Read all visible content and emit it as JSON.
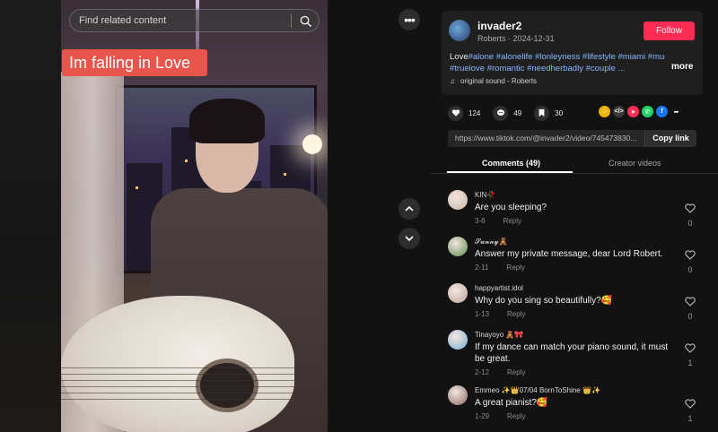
{
  "search": {
    "placeholder": "Find related content"
  },
  "video": {
    "caption_sticker": "Im falling in Love"
  },
  "author": {
    "username": "invader2",
    "nickname": "Roberts",
    "date": "2024-12-31",
    "follow_label": "Follow"
  },
  "description": {
    "line1_prefix": "Love",
    "line1_tags": [
      "#alone",
      "#alonelife",
      "#lonleyness",
      "#lifestyle",
      "#miami",
      "#music"
    ],
    "line2_tags": [
      "#truelove",
      "#romantic",
      "#needherbadly",
      "#couple ..."
    ],
    "more_label": "more"
  },
  "sound": {
    "label": "original sound - Roberts"
  },
  "actions": {
    "likes": "124",
    "comments": "49",
    "saves": "30"
  },
  "share_icons": [
    {
      "name": "embed-share-icon",
      "glyph": "</>",
      "color": "#3a3a3a"
    },
    {
      "name": "friends-share-icon",
      "glyph": "➤",
      "color": "#fe2c55"
    },
    {
      "name": "whatsapp-share-icon",
      "glyph": "✆",
      "color": "#25d366"
    },
    {
      "name": "facebook-share-icon",
      "glyph": "f",
      "color": "#1877f2"
    },
    {
      "name": "forward-share-icon",
      "glyph": "➦",
      "color": "transparent"
    }
  ],
  "link": {
    "url": "https://www.tiktok.com/@invader2/video/745473830...",
    "copy_label": "Copy link"
  },
  "tabs": {
    "comments": "Comments (49)",
    "creator": "Creator videos"
  },
  "comments": [
    {
      "user": "KIN🥀",
      "text": [
        "Are you sleeping?"
      ],
      "date": "3-8",
      "reply": "Reply",
      "likes": "0",
      "avatar_color": "#c9b7a9"
    },
    {
      "user": "𝓢𝓾𝓷𝓷𝔂🧸",
      "text": [
        "Answer my private message, dear Lord Robert."
      ],
      "date": "2-11",
      "reply": "Reply",
      "likes": "0",
      "avatar_color": "#5e8a4c"
    },
    {
      "user": "happyartist.idol",
      "text": [
        "Why do you sing so beautifully?🥰"
      ],
      "date": "1-13",
      "reply": "Reply",
      "likes": "0",
      "avatar_color": "#bca59a"
    },
    {
      "user": "Tinayoyo 🧸🎀",
      "text": [
        "If my dance can match your piano sound, it must",
        "be great."
      ],
      "date": "2-12",
      "reply": "Reply",
      "likes": "1",
      "avatar_color": "#7fb0d6"
    },
    {
      "user": "Emmeo ✨👑07/04 BornToShine 👑✨",
      "text": [
        "A great pianist?🥰"
      ],
      "date": "1-29",
      "reply": "Reply",
      "likes": "1",
      "avatar_color": "#8a6a62"
    }
  ]
}
